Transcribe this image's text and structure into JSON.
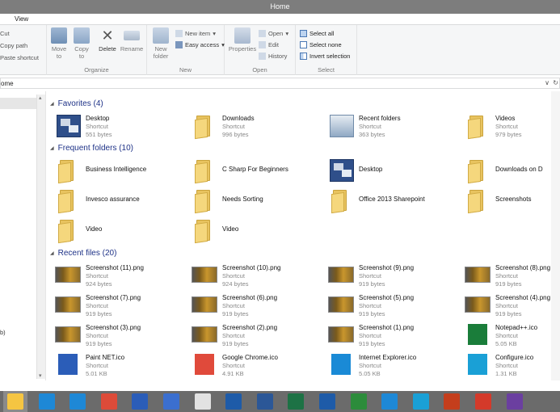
{
  "window": {
    "title": "Home"
  },
  "menu": {
    "view": "View"
  },
  "ribbon": {
    "clipboard": {
      "cut": "Cut",
      "copy_path": "Copy path",
      "paste_shortcut": "Paste shortcut"
    },
    "organize": {
      "move_to": "Move to",
      "copy_to": "Copy to",
      "delete": "Delete",
      "rename": "Rename",
      "label": "Organize"
    },
    "new": {
      "new_folder": "New folder",
      "new_item": "New item",
      "easy_access": "Easy access",
      "label": "New"
    },
    "open": {
      "properties": "Properties",
      "open": "Open",
      "edit": "Edit",
      "history": "History",
      "label": "Open"
    },
    "select": {
      "select_all": "Select all",
      "select_none": "Select none",
      "invert": "Invert selection",
      "label": "Select"
    }
  },
  "address": {
    "text": "ome"
  },
  "nav": {
    "item_bottom": "b)"
  },
  "favorites": {
    "heading": "Favorites (4)",
    "items": [
      {
        "name": "Desktop",
        "sub1": "Shortcut",
        "sub2": "551 bytes",
        "icon": "desktop-icon"
      },
      {
        "name": "Downloads",
        "sub1": "Shortcut",
        "sub2": "996 bytes",
        "icon": "folder-icon"
      },
      {
        "name": "Recent folders",
        "sub1": "Shortcut",
        "sub2": "363 bytes",
        "icon": "recent-folders-icon"
      },
      {
        "name": "Videos",
        "sub1": "Shortcut",
        "sub2": "979 bytes",
        "icon": "folder-icon"
      }
    ]
  },
  "frequent": {
    "heading": "Frequent folders (10)",
    "items": [
      {
        "name": "Business Intelligence",
        "icon": "folder-icon"
      },
      {
        "name": "C Sharp For Beginners",
        "icon": "folder-icon"
      },
      {
        "name": "Desktop",
        "icon": "desktop-icon"
      },
      {
        "name": "Downloads on D",
        "icon": "folder-icon"
      },
      {
        "name": "Invesco assurance",
        "icon": "folder-icon"
      },
      {
        "name": "Needs Sorting",
        "icon": "folder-icon"
      },
      {
        "name": "Office 2013 Sharepoint",
        "icon": "folder-icon"
      },
      {
        "name": "Screenshots",
        "icon": "folder-icon"
      },
      {
        "name": "Video",
        "icon": "folder-icon"
      },
      {
        "name": "Video",
        "icon": "folder-icon"
      }
    ]
  },
  "recent": {
    "heading": "Recent files (20)",
    "items": [
      {
        "name": "Screenshot (11).png",
        "sub1": "Shortcut",
        "sub2": "924 bytes"
      },
      {
        "name": "Screenshot (10).png",
        "sub1": "Shortcut",
        "sub2": "924 bytes"
      },
      {
        "name": "Screenshot (9).png",
        "sub1": "Shortcut",
        "sub2": "919 bytes"
      },
      {
        "name": "Screenshot (8).png",
        "sub1": "Shortcut",
        "sub2": "919 bytes"
      },
      {
        "name": "Screenshot (7).png",
        "sub1": "Shortcut",
        "sub2": "919 bytes"
      },
      {
        "name": "Screenshot (6).png",
        "sub1": "Shortcut",
        "sub2": "919 bytes"
      },
      {
        "name": "Screenshot (5).png",
        "sub1": "Shortcut",
        "sub2": "919 bytes"
      },
      {
        "name": "Screenshot (4).png",
        "sub1": "Shortcut",
        "sub2": "919 bytes"
      },
      {
        "name": "Screenshot (3).png",
        "sub1": "Shortcut",
        "sub2": "919 bytes"
      },
      {
        "name": "Screenshot (2).png",
        "sub1": "Shortcut",
        "sub2": "919 bytes"
      },
      {
        "name": "Screenshot (1).png",
        "sub1": "Shortcut",
        "sub2": "919 bytes"
      },
      {
        "name": "Notepad++.ico",
        "sub1": "Shortcut",
        "sub2": "5.05 KB"
      },
      {
        "name": "Paint NET.ico",
        "sub1": "Shortcut",
        "sub2": "5.01 KB"
      },
      {
        "name": "Google Chrome.ico",
        "sub1": "Shortcut",
        "sub2": "4.91 KB"
      },
      {
        "name": "Internet Explorer.ico",
        "sub1": "Shortcut",
        "sub2": "5.05 KB"
      },
      {
        "name": "Configure.ico",
        "sub1": "Shortcut",
        "sub2": "1.31 KB"
      }
    ]
  },
  "taskbar": {
    "icons": [
      "file-explorer-icon",
      "settings-icon",
      "internet-explorer-icon",
      "chrome-icon",
      "remote-desktop-icon",
      "calculator-icon",
      "acrobat-icon",
      "outlook-icon",
      "word-icon",
      "excel-icon",
      "outlook-icon",
      "project-icon",
      "weather-icon",
      "skype-icon",
      "powerpoint-icon",
      "headphones-icon",
      "onenote-icon"
    ]
  },
  "colors": {
    "accent": "#1e3287",
    "titlebar": "#7d7d7d",
    "taskbar": "#6b6b6b",
    "folder": "#f5d77d"
  }
}
